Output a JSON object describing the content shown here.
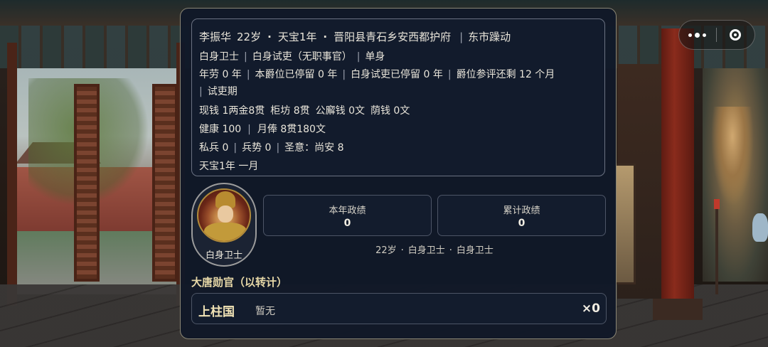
{
  "info": {
    "name": "李振华",
    "age": "22岁",
    "era": "天宝1年",
    "location": "晋阳县青石乡安西都护府",
    "event": "东市躁动",
    "rank1": "白身卫士",
    "rank2": "白身试吏（无职事官）",
    "marital": "单身",
    "merit_years": "年劳 0 年",
    "title_stay": "本爵位已停留 0 年",
    "post_stay": "白身试吏已停留 0 年",
    "review": "爵位参评还剩 12 个月",
    "probation": "试吏期",
    "cash": "现钱 1两金8贯",
    "shop": "柜坊 8贯",
    "public_fund": "公廨钱 0文",
    "yin_fund": "荫钱 0文",
    "health": "健康 100",
    "salary": "月俸 8贯180文",
    "private_troops": "私兵 0",
    "military": "兵势 0",
    "imperial": "圣意：尚安 8",
    "date": "天宝1年 一月"
  },
  "profile": {
    "avatar_label": "白身卫士",
    "year_title": "本年政绩",
    "year_value": "0",
    "total_title": "累计政绩",
    "total_value": "0",
    "sub_age": "22岁",
    "sub_rank1": "白身卫士",
    "sub_rank2": "白身卫士"
  },
  "honors": {
    "title": "大唐勋官（以转计）",
    "items": [
      {
        "name": "上柱国",
        "status": "暂无",
        "count": "×0"
      }
    ]
  },
  "menu": {
    "more_icon": "more-dots-icon",
    "close_icon": "close-target-icon"
  }
}
